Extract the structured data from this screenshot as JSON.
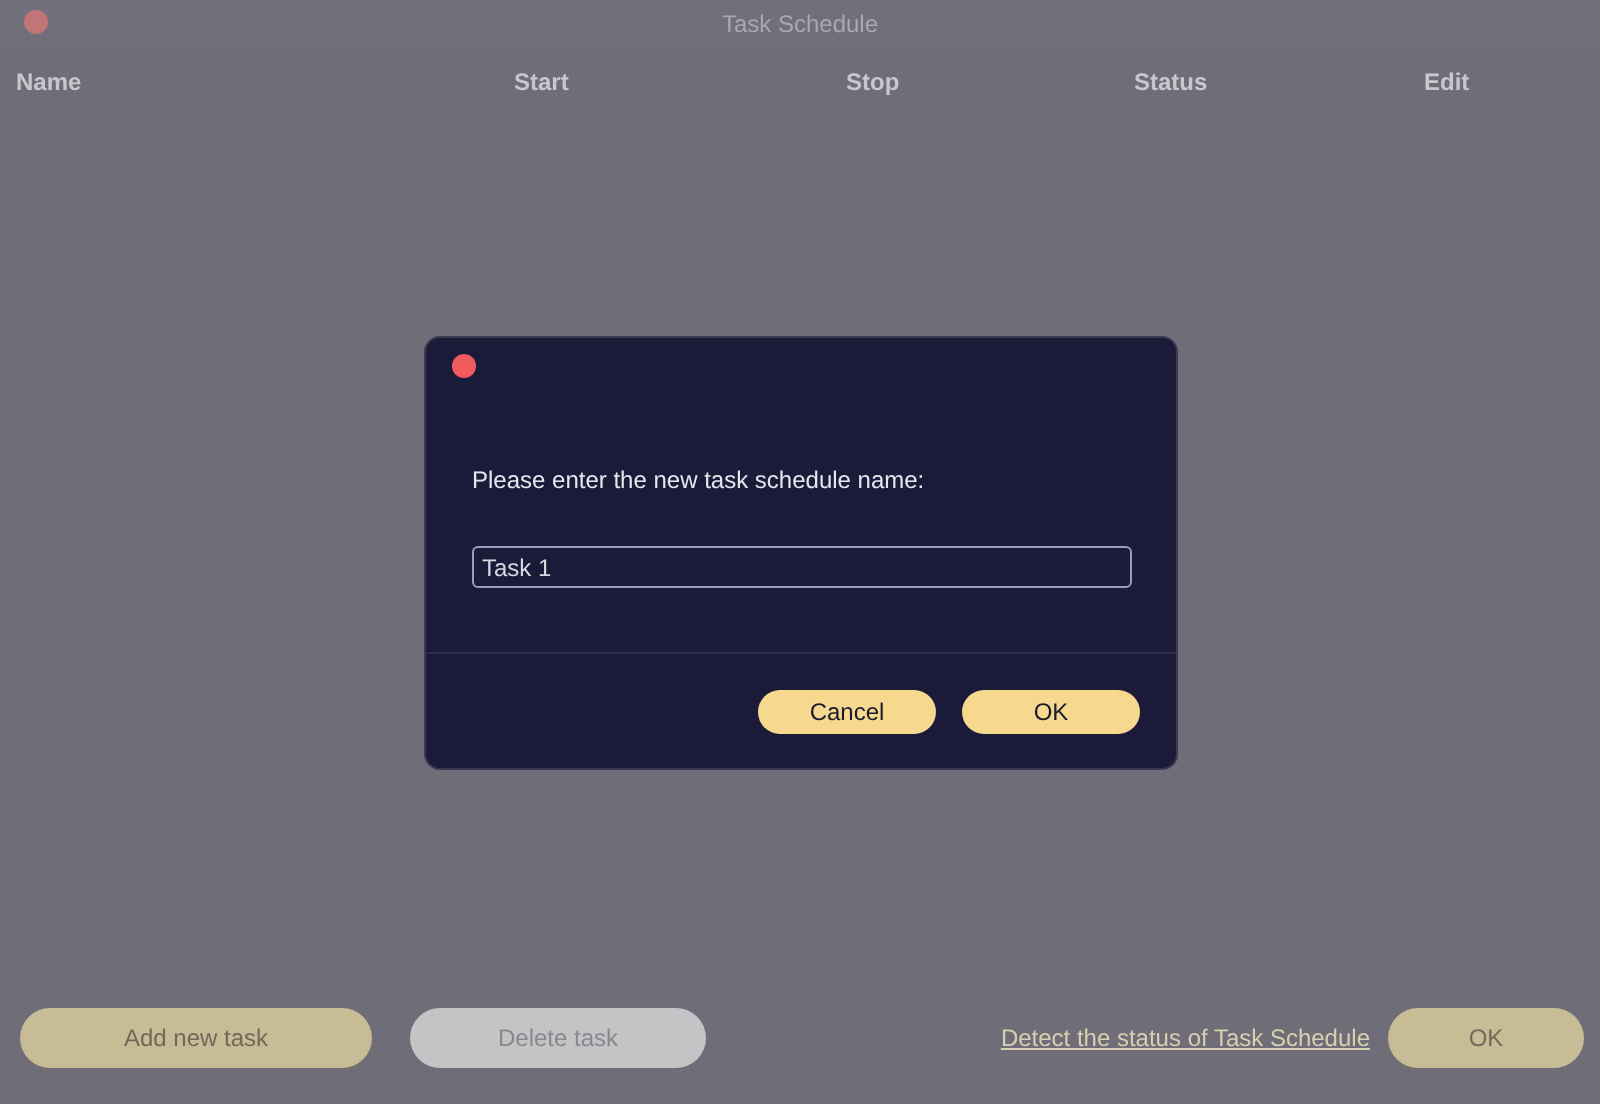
{
  "window": {
    "title": "Task Schedule"
  },
  "table": {
    "columns": [
      "Name",
      "Start",
      "Stop",
      "Status",
      "Edit"
    ]
  },
  "footer": {
    "buttons": [
      {
        "label": "Add new task",
        "disabled": false
      },
      {
        "label": "Delete task",
        "disabled": true
      }
    ],
    "link": "Detect the status of Task Schedule",
    "ok_button": "OK"
  },
  "dialog": {
    "prompt": "Please enter the new task schedule name:",
    "field": {
      "value": "Task 1"
    },
    "buttons": [
      "Cancel",
      "OK"
    ]
  }
}
